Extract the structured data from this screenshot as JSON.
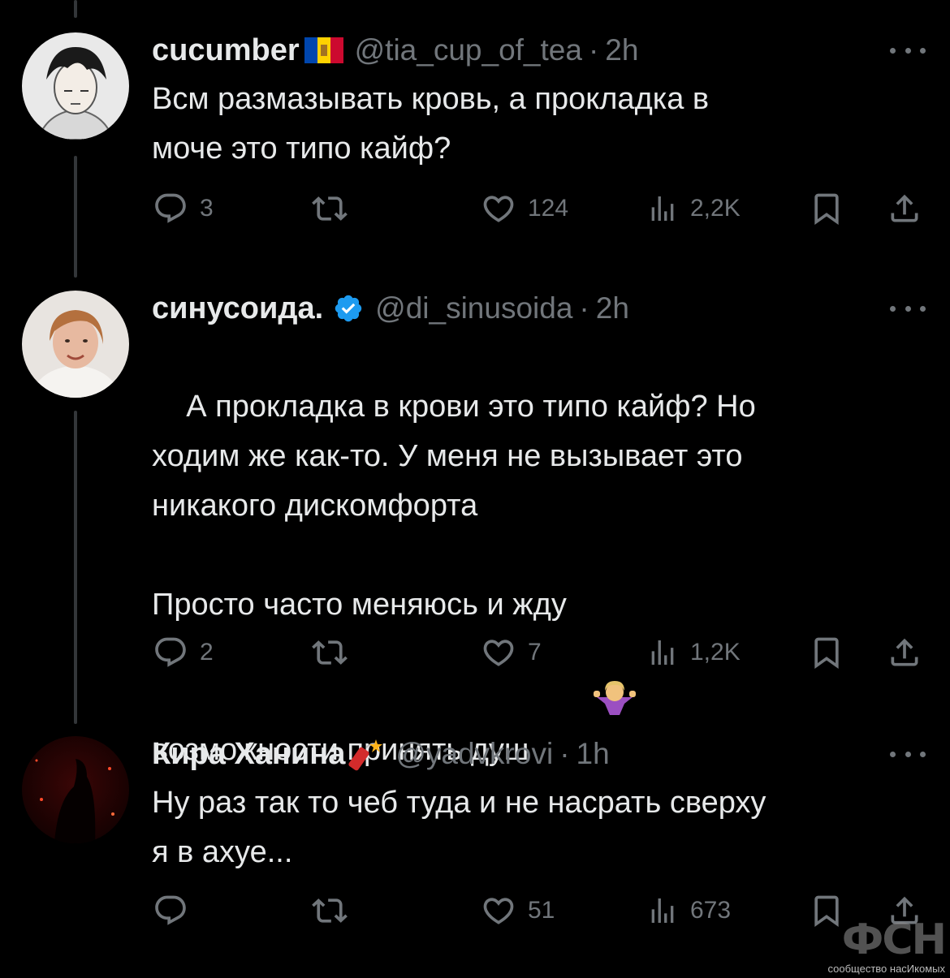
{
  "tweets": [
    {
      "name": "cucumber",
      "handle": "@tia_cup_of_tea",
      "separator": "·",
      "time": "2h",
      "text": "Всм размазывать кровь, а прокладка в\nмоче это типо кайф?",
      "replies": "3",
      "retweets": "",
      "likes": "124",
      "views": "2,2K",
      "badge": "moldova-flag-icon",
      "avatar": "anime-character-avatar"
    },
    {
      "name": "синусоида.",
      "handle": "@di_sinusoida",
      "separator": "·",
      "time": "2h",
      "text": "А прокладка в крови это типо кайф? Но\nходим же как-то. У меня не вызывает это\nникакого дискомфорта\n\nПросто часто меняюсь и жду\nвозможности принять душ",
      "emoji": "person-shrugging-emoji",
      "replies": "2",
      "retweets": "",
      "likes": "7",
      "views": "1,2K",
      "badge": "verified-badge-icon",
      "avatar": "woman-photo-avatar"
    },
    {
      "name": "Кира Ханина",
      "handle": "@yadvkrovi",
      "separator": "·",
      "time": "1h",
      "text": "Ну раз так то чеб туда и не насрать сверху\nя в ахуе...",
      "replies": "",
      "retweets": "",
      "likes": "51",
      "views": "673",
      "badge": "firecracker-emoji",
      "avatar": "dark-red-photo-avatar"
    }
  ],
  "watermark": {
    "logo": "ФСН",
    "caption": "сообщество насИкомых"
  },
  "colors": {
    "background": "#000000",
    "text": "#e7e9ea",
    "secondary": "#71767b",
    "verified": "#1d9bf0",
    "thread_line": "#333639"
  }
}
